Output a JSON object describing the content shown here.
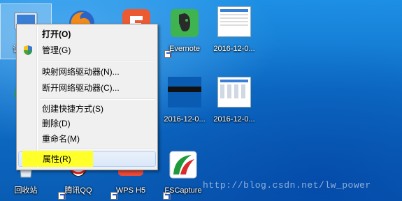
{
  "desktop": {
    "icons": {
      "computer": {
        "label": "计"
      },
      "firefox": {
        "label": ""
      },
      "wps": {
        "label": ""
      },
      "evernote": {
        "label": "Evernote"
      },
      "file1": {
        "label": "2016-12-0..."
      },
      "ie": {
        "label": ""
      },
      "file2": {
        "label": "2016-12-0..."
      },
      "file3": {
        "label": "2016-12-0..."
      },
      "recycle": {
        "label": "回收站"
      },
      "qq": {
        "label": "腾讯QQ"
      },
      "wpsh5": {
        "label": "WPS H5"
      },
      "fscapture": {
        "label": "FSCapture"
      }
    }
  },
  "context_menu": {
    "items": [
      {
        "label": "打开(O)",
        "bold": true
      },
      {
        "label": "管理(G)",
        "icon": "shield-icon"
      },
      {
        "label": "映射网络驱动器(N)..."
      },
      {
        "label": "断开网络驱动器(C)..."
      },
      {
        "label": "创建快捷方式(S)"
      },
      {
        "label": "删除(D)"
      },
      {
        "label": "重命名(M)"
      },
      {
        "label": "属性(R)",
        "highlighted": true
      }
    ]
  },
  "watermark": "http://blog.csdn.net/lw_power",
  "colors": {
    "desktop": "#0e6fc8",
    "highlight": "#ffff2a",
    "menu_bg": "#f0f0f0"
  }
}
